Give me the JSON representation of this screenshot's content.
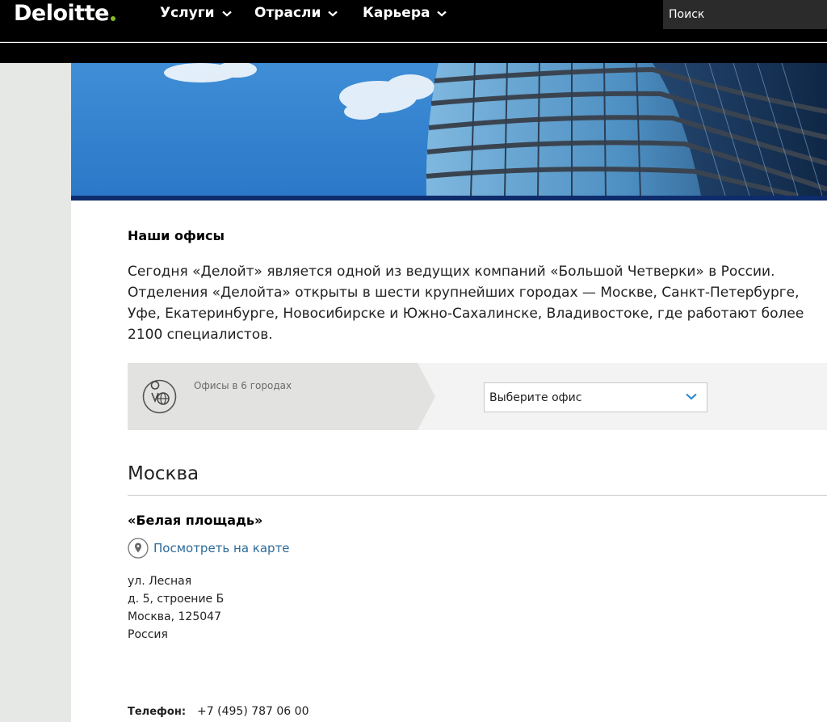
{
  "header": {
    "logo_text": "Deloitte",
    "logo_dot_color": "#86bc25",
    "nav": [
      {
        "label": "Услуги"
      },
      {
        "label": "Отрасли"
      },
      {
        "label": "Карьера"
      }
    ],
    "search_placeholder": "Поиск"
  },
  "content": {
    "section_title": "Наши офисы",
    "intro": "Сегодня «Делойт» является одной из ведущих компаний «Большой Четверки» в России. Отделения «Делойта» открыты в шести крупнейших городах — Москве, Санкт-Петербурге, Уфе, Екатеринбурге, Новосибирске и Южно-Сахалинске, Владивостоке, где работают более 2100 специалистов."
  },
  "selector": {
    "offices_label": "Офисы в 6 городах",
    "select_label": "Выберите офис",
    "accent_color": "#2b8ccc"
  },
  "city": {
    "name": "Москва",
    "office_name": "«Белая площадь»",
    "map_link": "Посмотреть на карте",
    "address": [
      "ул. Лесная",
      "д. 5, строение Б",
      "Москва, 125047",
      "Россия"
    ],
    "phone_label": "Телефон:",
    "phone_value": "+7 (495) 787 06 00"
  }
}
